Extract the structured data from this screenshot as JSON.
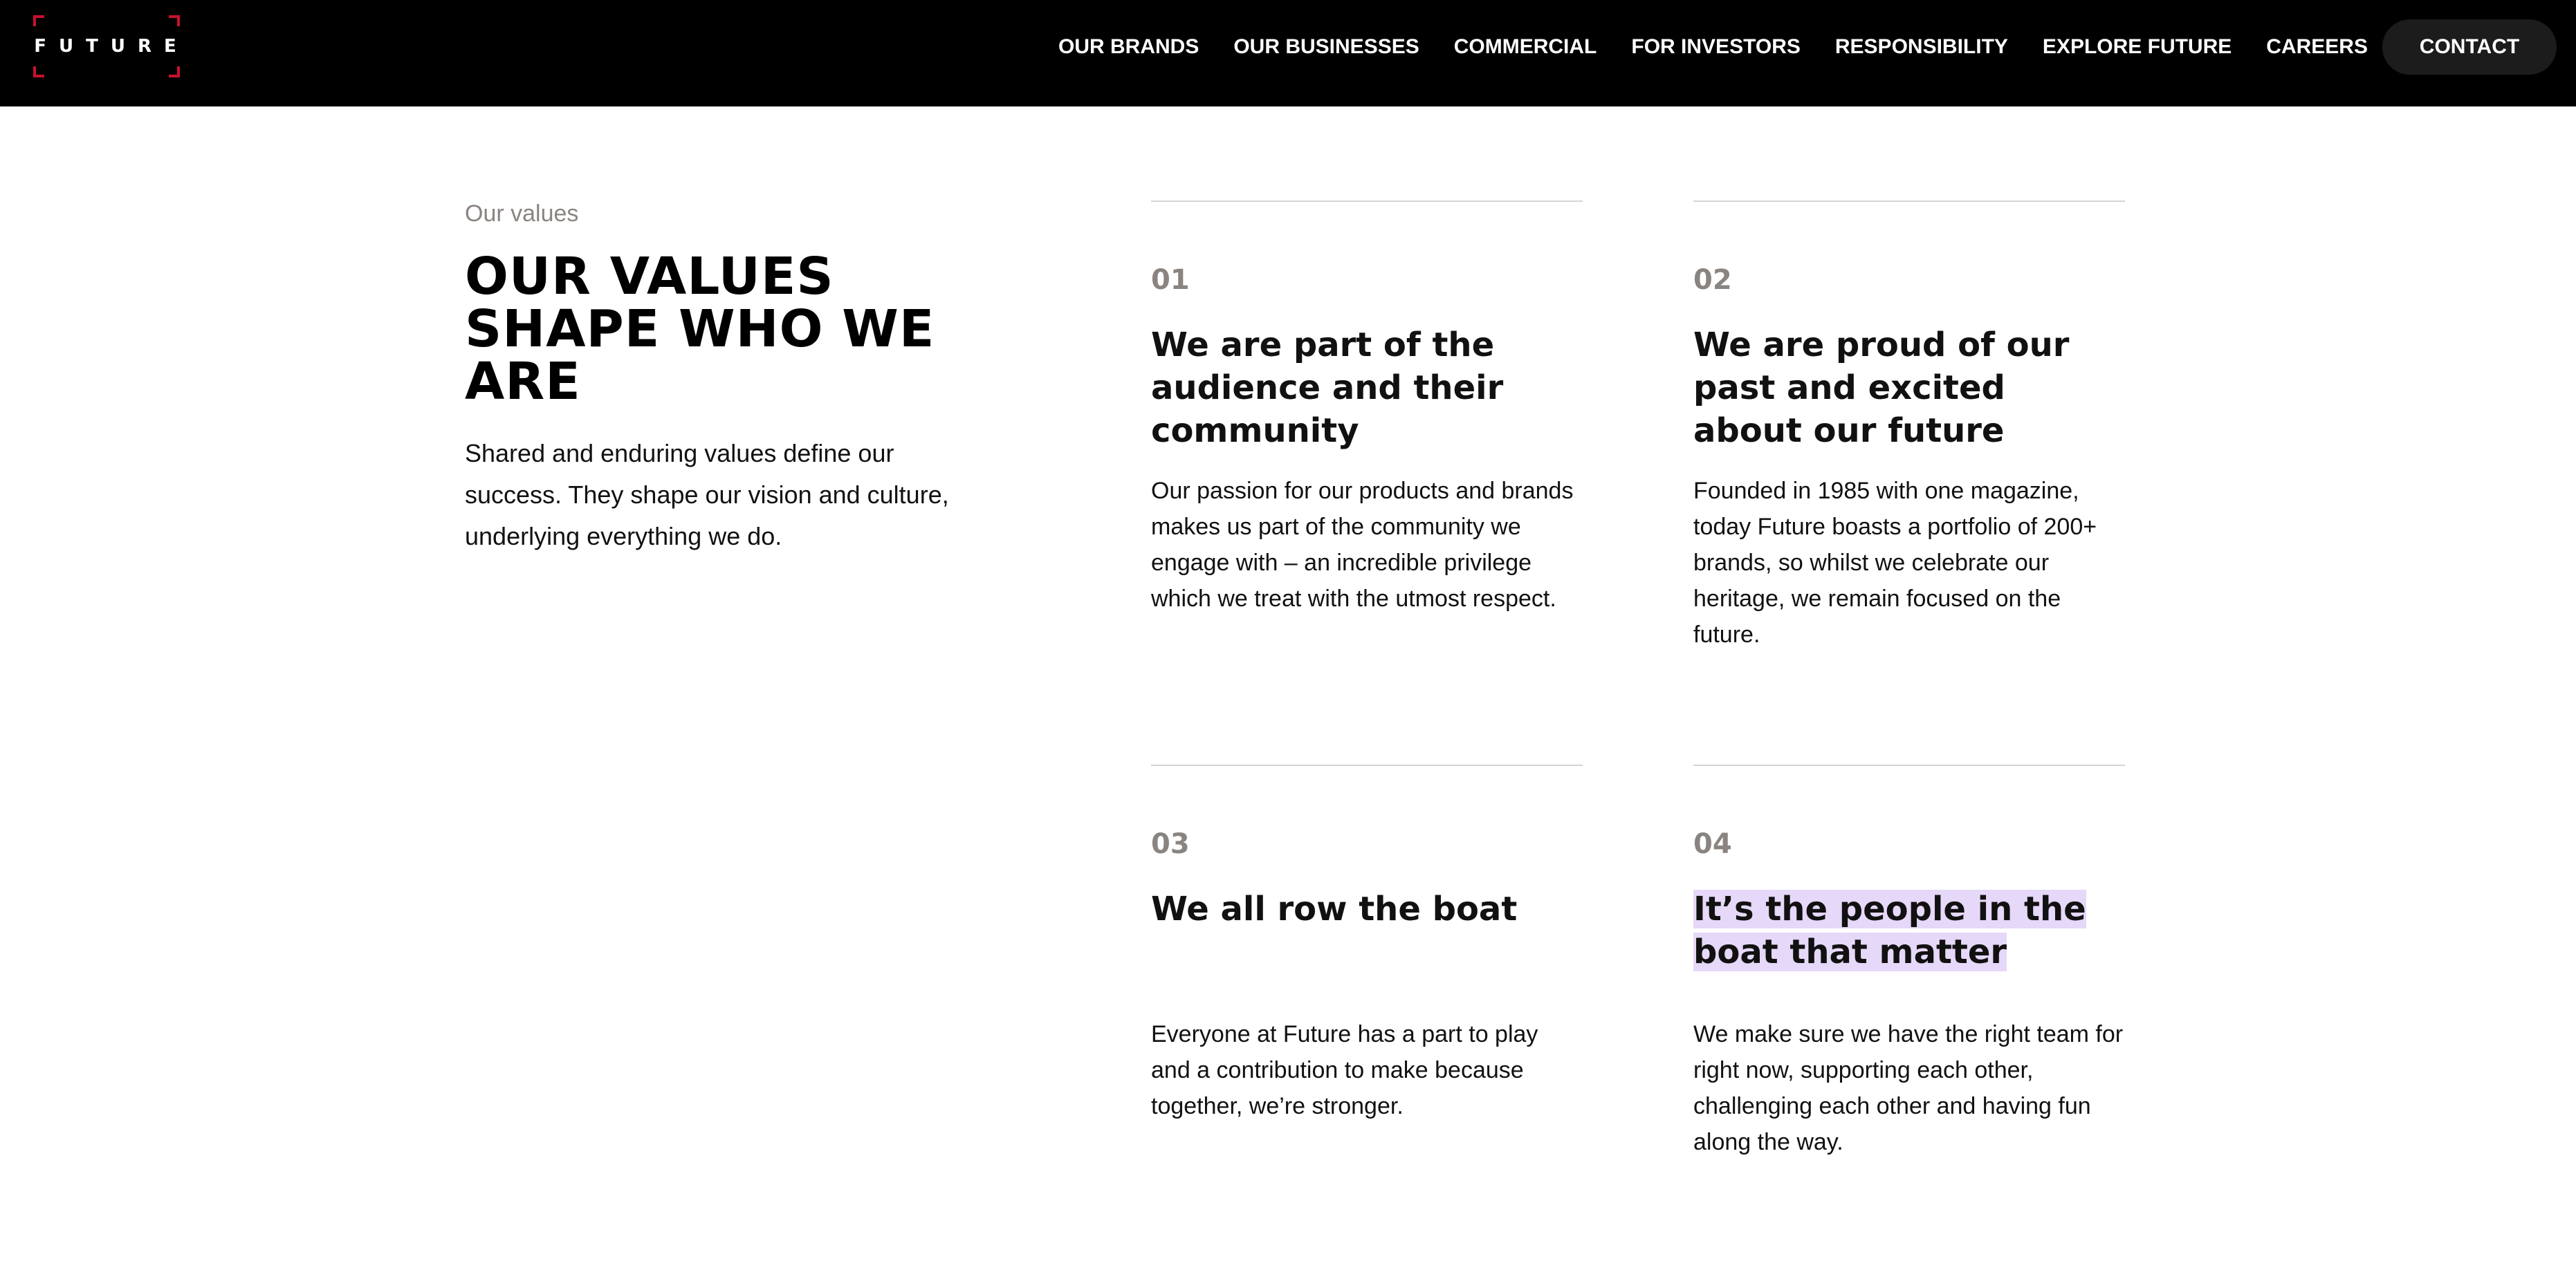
{
  "header": {
    "logo_text": "FUTURE",
    "nav": [
      {
        "label": "OUR BRANDS"
      },
      {
        "label": "OUR BUSINESSES"
      },
      {
        "label": "COMMERCIAL"
      },
      {
        "label": "FOR INVESTORS"
      },
      {
        "label": "RESPONSIBILITY"
      },
      {
        "label": "EXPLORE FUTURE"
      },
      {
        "label": "CAREERS"
      }
    ],
    "contact_label": "CONTACT"
  },
  "intro": {
    "eyebrow": "Our values",
    "title": "OUR VALUES SHAPE WHO WE ARE",
    "text": "Shared and enduring values define our success. They shape our vision and culture, underlying everything we do."
  },
  "values": [
    {
      "number": "01",
      "heading": "We are part of the audience and their community",
      "body": "Our passion for our products and brands makes us part of the community we engage with – an incredible privilege which we treat with the utmost respect."
    },
    {
      "number": "02",
      "heading": "We are proud of our past and excited about our future",
      "body": "Founded in 1985 with one magazine, today Future boasts a portfolio of 200+ brands, so whilst we celebrate our heritage, we remain focused on the future."
    },
    {
      "number": "03",
      "heading": "We all row the boat",
      "body": "Everyone at Future has a part to play and a contribution to make because together, we’re stronger."
    },
    {
      "number": "04",
      "heading": "It’s the people in the boat that matter",
      "body": "We make sure we have the right team for right now, supporting each other, challenging each other and having fun along the way."
    }
  ],
  "colors": {
    "header_bg": "#000000",
    "logo_accent": "#c8102e",
    "muted_text": "#8a8480",
    "rule": "#d4d4d4",
    "highlight": "#e6d8f8",
    "contact_bg": "#1c1c1c"
  }
}
